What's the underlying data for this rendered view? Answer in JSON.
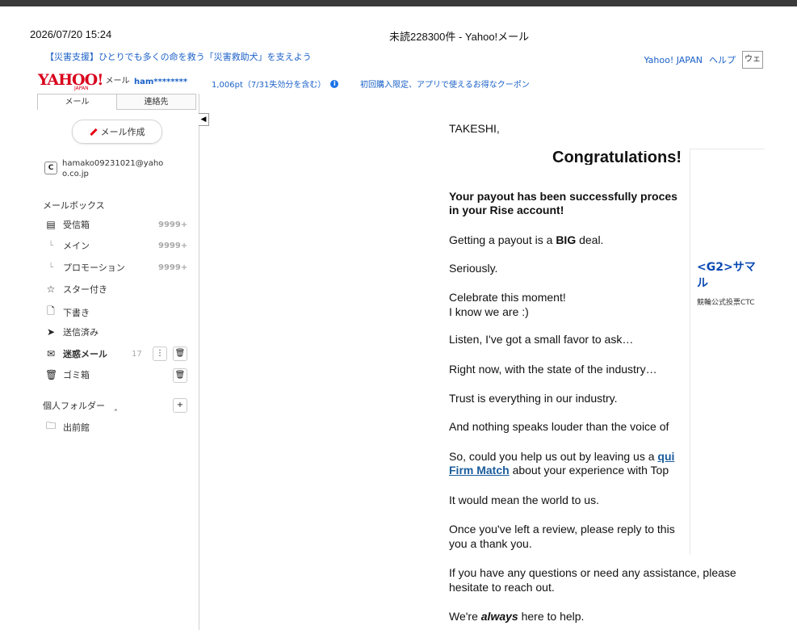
{
  "print_header": {
    "datetime": "2026/07/20 15:24",
    "window_title": "未読228300件 - Yahoo!メール"
  },
  "header": {
    "promo_link": "【災害支援】ひとりでも多くの命を救う「災害救助犬」を支えよう",
    "yahoo_japan_link": "Yahoo! JAPAN",
    "help_link": "ヘルプ",
    "web_search_label": "ウェ",
    "logo_text": "YAHOO!",
    "logo_japan": "JAPAN",
    "logo_service": "メール",
    "user_id": "ham********",
    "points": "1,006pt（7/31失効分を含む）",
    "coupon_link": "初回購入限定、アプリで使えるお得なクーポン"
  },
  "sidebar": {
    "tabs": [
      {
        "label": "メール",
        "active": true
      },
      {
        "label": "連絡先",
        "active": false
      }
    ],
    "compose_label": "メール作成",
    "account_email": "hamako09231021@yahoo.co.jp",
    "mailbox_label": "メールボックス",
    "folders": [
      {
        "name": "inbox",
        "label": "受信箱",
        "count": "9999+",
        "icon": "inbox-icon"
      },
      {
        "name": "main",
        "label": "メイン",
        "count": "9999+",
        "icon": "sub-branch-icon"
      },
      {
        "name": "promotion",
        "label": "プロモーション",
        "count": "9999+",
        "icon": "sub-branch-icon"
      },
      {
        "name": "starred",
        "label": "スター付き",
        "count": "",
        "icon": "star-icon"
      },
      {
        "name": "drafts",
        "label": "下書き",
        "count": "",
        "icon": "draft-icon"
      },
      {
        "name": "sent",
        "label": "送信済み",
        "count": "",
        "icon": "send-icon"
      },
      {
        "name": "spam",
        "label": "迷惑メール",
        "count": "17",
        "icon": "spam-icon"
      },
      {
        "name": "trash",
        "label": "ゴミ箱",
        "count": "",
        "icon": "trash-icon"
      }
    ],
    "personal_folders_label": "個人フォルダー",
    "personal_folders": [
      {
        "label": "出前館",
        "icon": "folder-icon"
      }
    ]
  },
  "email": {
    "greeting": "TAKESHI,",
    "headline": "Congratulations!",
    "para1_line1": "Your payout has been successfully proces",
    "para1_line2": "in your Rise account!",
    "para2_pre": "Getting a payout is a ",
    "para2_bold": "BIG",
    "para2_post": " deal.",
    "para3": "Seriously.",
    "para4_line1": "Celebrate this moment!",
    "para4_line2": "I know we are :)",
    "para5": "Listen, I've got a small favor to ask…",
    "para6": "Right now, with the state of the industry…",
    "para7": "Trust is everything in our industry.",
    "para8": "And nothing speaks louder than the voice of",
    "para9_pre": "So, could you help us out by leaving us a ",
    "para9_link": "qui",
    "para9_line2_link": "Firm Match",
    "para9_line2_post": " about your experience with Top",
    "para10": "It would mean the world to us.",
    "para11_line1": "Once you've left a review, please reply to this",
    "para11_line2": "you a thank you.",
    "para12_line1": "If you have any questions or need any assistance, please",
    "para12_line2": "hesitate to reach out.",
    "para13_pre": "We're ",
    "para13_bold": "always",
    "para13_post": " here to help."
  },
  "ad": {
    "title_line1": "<G2>サマ",
    "title_line2": "ル",
    "subtitle": "競輪公式投票CTC"
  }
}
